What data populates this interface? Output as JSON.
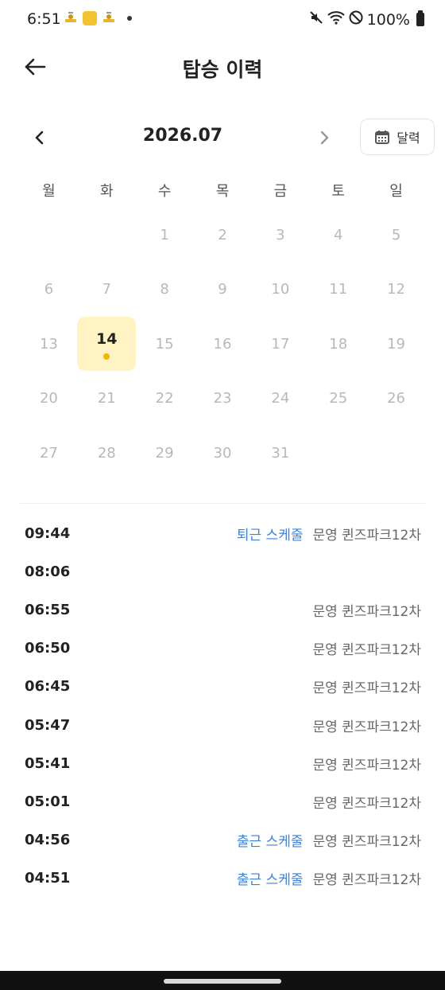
{
  "status_bar": {
    "time": "6:51",
    "battery": "100%",
    "icons": [
      "mute-icon",
      "wifi-icon",
      "do-not-disturb-icon",
      "battery-icon"
    ]
  },
  "header": {
    "title": "탑승 이력",
    "back_icon": "back-arrow-icon"
  },
  "calendar": {
    "month_label": "2026.07",
    "calendar_button_label": "달력",
    "weekdays": [
      "월",
      "화",
      "수",
      "목",
      "금",
      "토",
      "일"
    ],
    "days": [
      "",
      "",
      "1",
      "2",
      "3",
      "4",
      "5",
      "6",
      "7",
      "8",
      "9",
      "10",
      "11",
      "12",
      "13",
      "14",
      "15",
      "16",
      "17",
      "18",
      "19",
      "20",
      "21",
      "22",
      "23",
      "24",
      "25",
      "26",
      "27",
      "28",
      "29",
      "30",
      "31",
      "",
      ""
    ],
    "selected_day": "14",
    "colors": {
      "selected_bg": "#fff3c4",
      "dot": "#f5b400"
    }
  },
  "rides": [
    {
      "time": "09:44",
      "schedule": "퇴근 스케줄",
      "place": "문영 퀸즈파크12차"
    },
    {
      "time": "08:06",
      "schedule": "",
      "place": ""
    },
    {
      "time": "06:55",
      "schedule": "",
      "place": "문영 퀸즈파크12차"
    },
    {
      "time": "06:50",
      "schedule": "",
      "place": "문영 퀸즈파크12차"
    },
    {
      "time": "06:45",
      "schedule": "",
      "place": "문영 퀸즈파크12차"
    },
    {
      "time": "05:47",
      "schedule": "",
      "place": "문영 퀸즈파크12차"
    },
    {
      "time": "05:41",
      "schedule": "",
      "place": "문영 퀸즈파크12차"
    },
    {
      "time": "05:01",
      "schedule": "",
      "place": "문영 퀸즈파크12차"
    },
    {
      "time": "04:56",
      "schedule": "출근 스케줄",
      "place": "문영 퀸즈파크12차"
    },
    {
      "time": "04:51",
      "schedule": "출근 스케줄",
      "place": "문영 퀸즈파크12차"
    }
  ],
  "accent_colors": {
    "schedule_link": "#3b82d8"
  }
}
